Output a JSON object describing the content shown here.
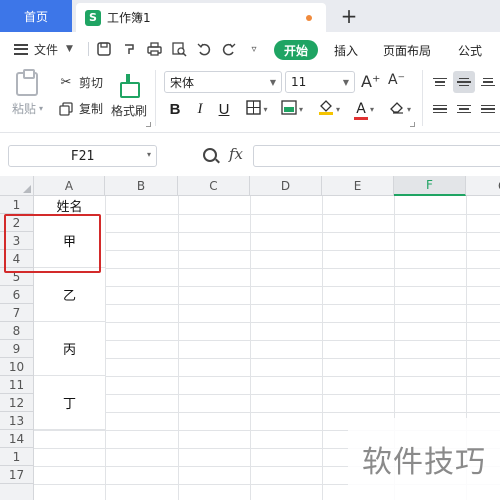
{
  "tabs": {
    "home_label": "首页",
    "doc_icon_letter": "S",
    "doc_label": "工作簿1",
    "new_tab_glyph": "+"
  },
  "menu": {
    "file_label": "文件",
    "tabs": [
      "开始",
      "插入",
      "页面布局",
      "公式"
    ],
    "active_tab": "开始",
    "quick_access_icons": [
      "save-icon",
      "format-painter-icon",
      "print-icon",
      "print-preview-icon",
      "undo-icon",
      "redo-icon",
      "customize-icon"
    ]
  },
  "ribbon": {
    "paste_label": "粘贴",
    "cut_label": "剪切",
    "copy_label": "复制",
    "format_painter_label": "格式刷",
    "font_name": "宋体",
    "font_size": "11",
    "bold_glyph": "B",
    "italic_glyph": "I",
    "underline_glyph": "U",
    "font_color_glyph": "A",
    "increase_font_glyph": "A⁺",
    "decrease_font_glyph": "A⁻",
    "accent_colors": {
      "fill": "#f5c400",
      "font": "#e03131",
      "brand": "#1fa463"
    }
  },
  "formula_bar": {
    "cell_ref": "F21",
    "fx_label": "fx",
    "formula_value": ""
  },
  "sheet": {
    "columns": [
      "A",
      "B",
      "C",
      "D",
      "E",
      "F",
      "G"
    ],
    "selected_column": "F",
    "rows": [
      "1",
      "2",
      "3",
      "4",
      "5",
      "6",
      "7",
      "8",
      "9",
      "10",
      "11",
      "12",
      "13",
      "14",
      "1",
      "17"
    ],
    "header_cell": "姓名",
    "merged_values": [
      "甲",
      "乙",
      "丙",
      "丁"
    ]
  },
  "watermark": "软件技巧"
}
